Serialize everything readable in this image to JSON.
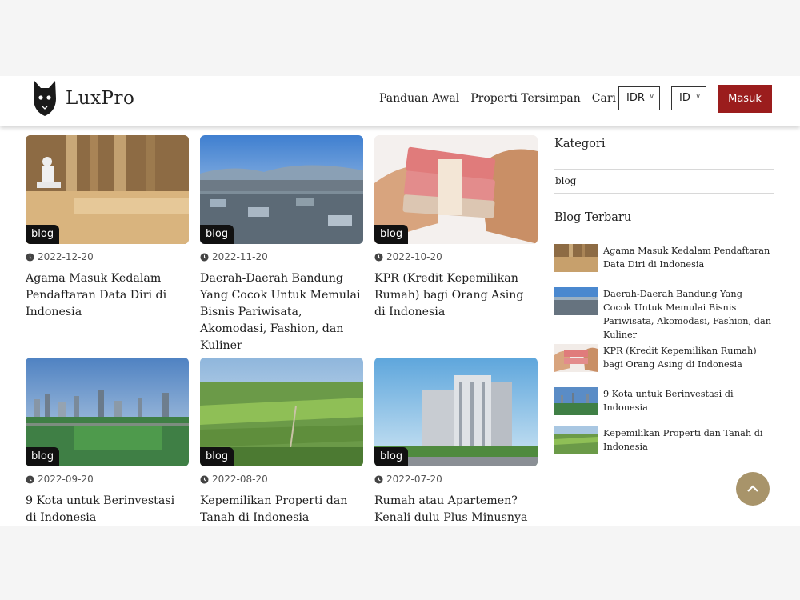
{
  "header": {
    "brand": "LuxPro",
    "nav": [
      "Panduan Awal",
      "Properti Tersimpan",
      "Cari Agen"
    ],
    "currency": "IDR",
    "language": "ID",
    "login_label": "Masuk"
  },
  "posts": [
    {
      "tag": "blog",
      "date": "2022-12-20",
      "title": "Agama Masuk Kedalam Pendaftaran Data Diri di Indonesia"
    },
    {
      "tag": "blog",
      "date": "2022-11-20",
      "title": "Daerah-Daerah Bandung Yang Cocok Untuk Memulai Bisnis Pariwisata, Akomodasi, Fashion, dan Kuliner"
    },
    {
      "tag": "blog",
      "date": "2022-10-20",
      "title": "KPR (Kredit Kepemilikan Rumah) bagi Orang Asing di Indonesia"
    },
    {
      "tag": "blog",
      "date": "2022-09-20",
      "title": "9 Kota untuk Berinvestasi di Indonesia"
    },
    {
      "tag": "blog",
      "date": "2022-08-20",
      "title": "Kepemilikan Properti dan Tanah di Indonesia"
    },
    {
      "tag": "blog",
      "date": "2022-07-20",
      "title": "Rumah atau Apartemen? Kenali dulu Plus Minusnya"
    }
  ],
  "sidebar": {
    "categories_heading": "Kategori",
    "categories": [
      "blog"
    ],
    "recent_heading": "Blog Terbaru",
    "recent": [
      "Agama Masuk Kedalam Pendaftaran Data Diri di Indonesia",
      "Daerah-Daerah Bandung Yang Cocok Untuk Memulai Bisnis Pariwisata, Akomodasi, Fashion, dan Kuliner",
      "KPR (Kredit Kepemilikan Rumah) bagi Orang Asing di Indonesia",
      "9 Kota untuk Berinvestasi di Indonesia",
      "Kepemilikan Properti dan Tanah di Indonesia"
    ]
  },
  "colors": {
    "login_button": "#9b1d1d",
    "scroll_top_button": "#a8946a"
  }
}
